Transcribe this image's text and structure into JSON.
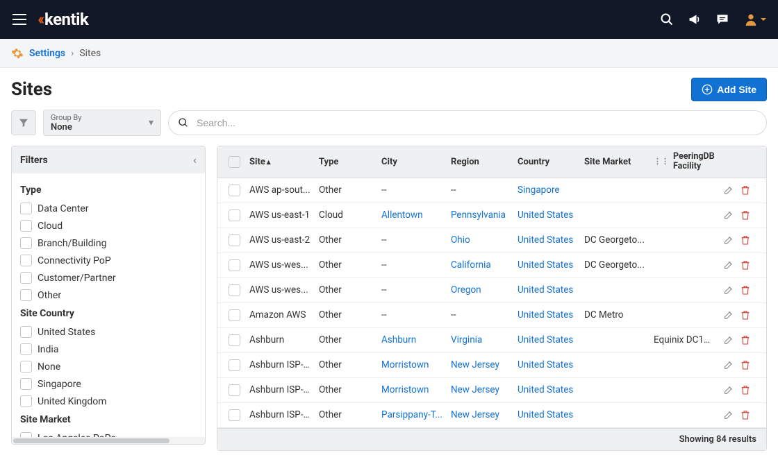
{
  "brand": {
    "name": "kentik"
  },
  "breadcrumb": {
    "link": "Settings",
    "current": "Sites"
  },
  "page": {
    "title": "Sites",
    "add_button": "Add Site"
  },
  "controls": {
    "groupby_label": "Group By",
    "groupby_value": "None",
    "search_placeholder": "Search..."
  },
  "filters": {
    "title": "Filters",
    "groups": [
      {
        "title": "Type",
        "items": [
          "Data Center",
          "Cloud",
          "Branch/Building",
          "Connectivity PoP",
          "Customer/Partner",
          "Other"
        ]
      },
      {
        "title": "Site Country",
        "items": [
          "United States",
          "India",
          "None",
          "Singapore",
          "United Kingdom"
        ]
      },
      {
        "title": "Site Market",
        "items": [
          "Los Angeles PoPs"
        ]
      }
    ]
  },
  "table": {
    "columns": {
      "site": "Site",
      "type": "Type",
      "city": "City",
      "region": "Region",
      "country": "Country",
      "market": "Site Market",
      "peer": "PeeringDB Facility"
    },
    "rows": [
      {
        "site": "AWS ap-sout...",
        "type": "Other",
        "city": "--",
        "city_link": false,
        "region": "--",
        "region_link": false,
        "country": "Singapore",
        "market": "",
        "peer": ""
      },
      {
        "site": "AWS us-east-1",
        "type": "Cloud",
        "city": "Allentown",
        "city_link": true,
        "region": "Pennsylvania",
        "region_link": true,
        "country": "United States",
        "market": "",
        "peer": ""
      },
      {
        "site": "AWS us-east-2",
        "type": "Other",
        "city": "--",
        "city_link": false,
        "region": "Ohio",
        "region_link": true,
        "country": "United States",
        "market": "DC Georgeto...",
        "peer": ""
      },
      {
        "site": "AWS us-wes...",
        "type": "Other",
        "city": "--",
        "city_link": false,
        "region": "California",
        "region_link": true,
        "country": "United States",
        "market": "DC Georgeto...",
        "peer": ""
      },
      {
        "site": "AWS us-wes...",
        "type": "Other",
        "city": "--",
        "city_link": false,
        "region": "Oregon",
        "region_link": true,
        "country": "United States",
        "market": "",
        "peer": ""
      },
      {
        "site": "Amazon AWS",
        "type": "Other",
        "city": "--",
        "city_link": false,
        "region": "--",
        "region_link": false,
        "country": "United States",
        "market": "DC Metro",
        "peer": ""
      },
      {
        "site": "Ashburn",
        "type": "Other",
        "city": "Ashburn",
        "city_link": true,
        "region": "Virginia",
        "region_link": true,
        "country": "United States",
        "market": "",
        "peer": "Equinix DC1-..."
      },
      {
        "site": "Ashburn ISP-...",
        "type": "Other",
        "city": "Morristown",
        "city_link": true,
        "region": "New Jersey",
        "region_link": true,
        "country": "United States",
        "market": "",
        "peer": ""
      },
      {
        "site": "Ashburn ISP-...",
        "type": "Other",
        "city": "Morristown",
        "city_link": true,
        "region": "New Jersey",
        "region_link": true,
        "country": "United States",
        "market": "",
        "peer": ""
      },
      {
        "site": "Ashburn ISP-...",
        "type": "Other",
        "city": "Parsippany-T...",
        "city_link": true,
        "region": "New Jersey",
        "region_link": true,
        "country": "United States",
        "market": "",
        "peer": ""
      }
    ],
    "footer": "Showing 84 results"
  }
}
